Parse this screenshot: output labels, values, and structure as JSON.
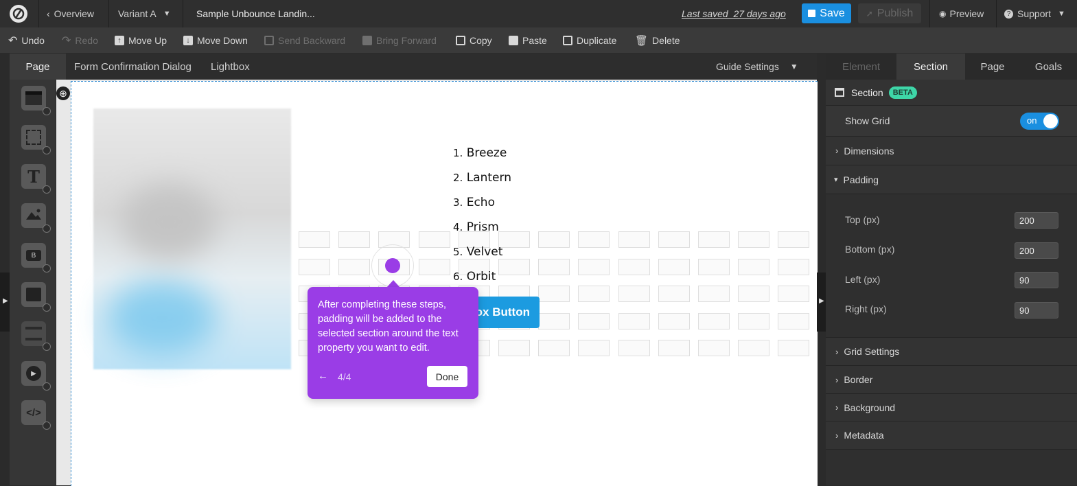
{
  "topbar": {
    "overview": "Overview",
    "variant": "Variant A",
    "page_name": "Sample Unbounce Landin...",
    "last_saved": "Last saved  27 days ago",
    "save": "Save",
    "publish": "Publish",
    "preview": "Preview",
    "support": "Support"
  },
  "toolbar": {
    "undo": "Undo",
    "redo": "Redo",
    "move_up": "Move Up",
    "move_down": "Move Down",
    "send_backward": "Send Backward",
    "bring_forward": "Bring Forward",
    "copy": "Copy",
    "paste": "Paste",
    "duplicate": "Duplicate",
    "delete": "Delete"
  },
  "canvas_tabs": {
    "page": "Page",
    "form_confirmation": "Form Confirmation Dialog",
    "lightbox": "Lightbox",
    "guide_settings": "Guide Settings"
  },
  "canvas": {
    "list": [
      {
        "num": "1.",
        "text": "Breeze"
      },
      {
        "num": "2.",
        "text": "Lantern"
      },
      {
        "num": "3.",
        "text": "Echo"
      },
      {
        "num": "4.",
        "text": "Prism"
      },
      {
        "num": "5.",
        "text": "Velvet"
      },
      {
        "num": "6.",
        "text": "Orbit"
      }
    ],
    "button_partial": "ox Button"
  },
  "tooltip": {
    "body": "After completing these steps, padding will be added to the selected section around the text property you want to edit.",
    "step": "4/4",
    "done": "Done"
  },
  "panel": {
    "tabs": {
      "element": "Element",
      "section": "Section",
      "page": "Page",
      "goals": "Goals"
    },
    "header": "Section",
    "beta": "BETA",
    "show_grid": "Show Grid",
    "toggle": "on",
    "dimensions": "Dimensions",
    "padding": "Padding",
    "top_label": "Top (px)",
    "top_value": "200",
    "bottom_label": "Bottom (px)",
    "bottom_value": "200",
    "left_label": "Left (px)",
    "left_value": "90",
    "right_label": "Right (px)",
    "right_value": "90",
    "grid_settings": "Grid Settings",
    "border": "Border",
    "background": "Background",
    "metadata": "Metadata"
  },
  "colors": {
    "save_blue": "#1a8fe0",
    "tooltip_purple": "#9a3de6",
    "beta_green": "#3ed6a8",
    "toggle_blue": "#1a8fe0"
  }
}
